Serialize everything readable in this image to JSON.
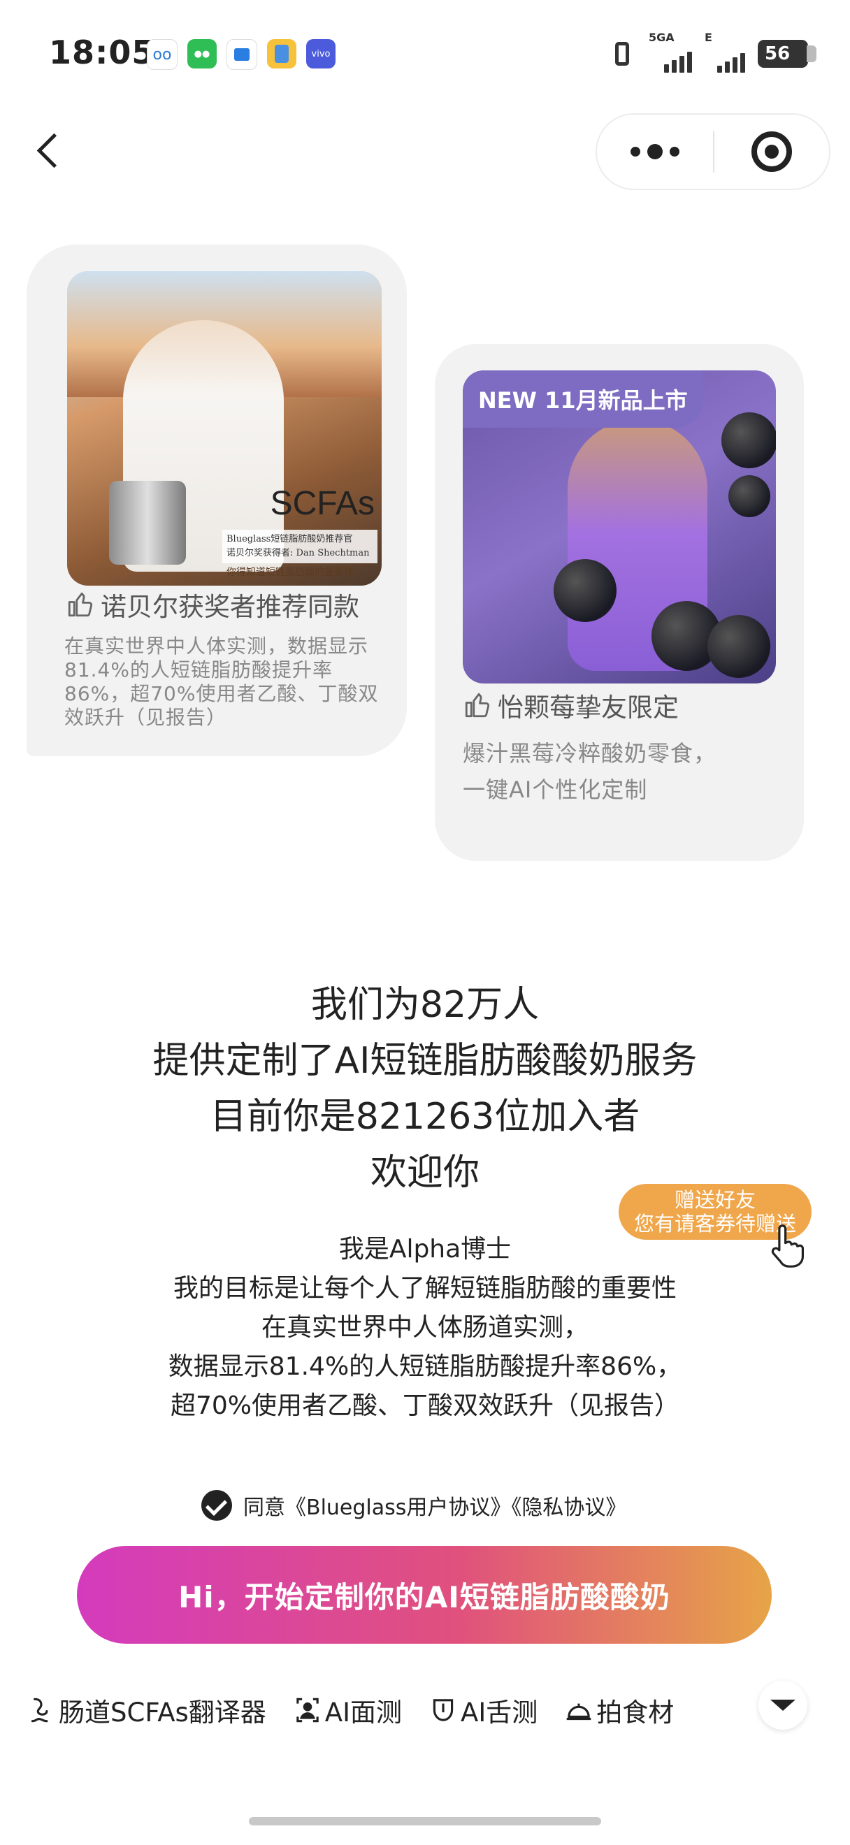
{
  "status_bar": {
    "time": "18:05",
    "network_label": "5GA",
    "network_label_2": "E",
    "battery": "56",
    "app_icons": [
      "voicemail-icon",
      "wechat-icon",
      "app-icon",
      "files-icon",
      "vivo-icon"
    ],
    "vivo_label": "vivo"
  },
  "nav": {
    "back_icon": "back-chevron-icon",
    "more_icon": "more-dots-icon",
    "close_icon": "target-close-icon"
  },
  "cards": [
    {
      "image_text": "SCFAs",
      "image_caption_1": "Blueglass短链脂肪酸奶推荐官",
      "image_caption_2": "诺贝尔奖获得者: Dan Shechtman",
      "image_caption_3": "你得知道短链脂肪酸的重要性",
      "title": "诺贝尔获奖者推荐同款",
      "desc_lines": [
        "在真实世界中人体实测，数据显示",
        "81.4%的人短链脂肪酸提升率",
        "86%，超70%使用者乙酸、丁酸双",
        "效跃升（见报告）"
      ]
    },
    {
      "image_tag": "NEW 11月新品上市",
      "title": "怡颗莓挚友限定",
      "desc_lines": [
        "爆汁黑莓冷粹酸奶零食，",
        "一键AI个性化定制"
      ]
    }
  ],
  "headline_lines": [
    "我们为82万人",
    "提供定制了AI短链脂肪酸酸奶服务",
    "目前你是821263位加入者",
    "欢迎你"
  ],
  "intro_lines": [
    "我是Alpha博士",
    "我的目标是让每个人了解短链脂肪酸的重要性",
    "在真实世界中人体肠道实测，",
    "数据显示81.4%的人短链脂肪酸提升率86%，",
    "超70%使用者乙酸、丁酸双效跃升（见报告）"
  ],
  "gift": {
    "line1": "赠送好友",
    "line2": "您有请客券待赠送"
  },
  "agree_text": "同意《Blueglass用户协议》《隐私协议》",
  "cta_label": "Hi，开始定制你的AI短链脂肪酸酸奶",
  "bottom_nav": [
    {
      "label": "肠道SCFAs翻译器",
      "icon": "gut-icon"
    },
    {
      "label": "AI面测",
      "icon": "face-scan-icon"
    },
    {
      "label": "AI舌测",
      "icon": "tongue-icon"
    },
    {
      "label": "拍食材",
      "icon": "food-cover-icon"
    }
  ],
  "colors": {
    "cta_start": "#d43bbd",
    "cta_mid": "#e0517d",
    "cta_end": "#e6a447",
    "gift_bg": "#f0a74c",
    "card_bg": "#f2f2f2"
  }
}
